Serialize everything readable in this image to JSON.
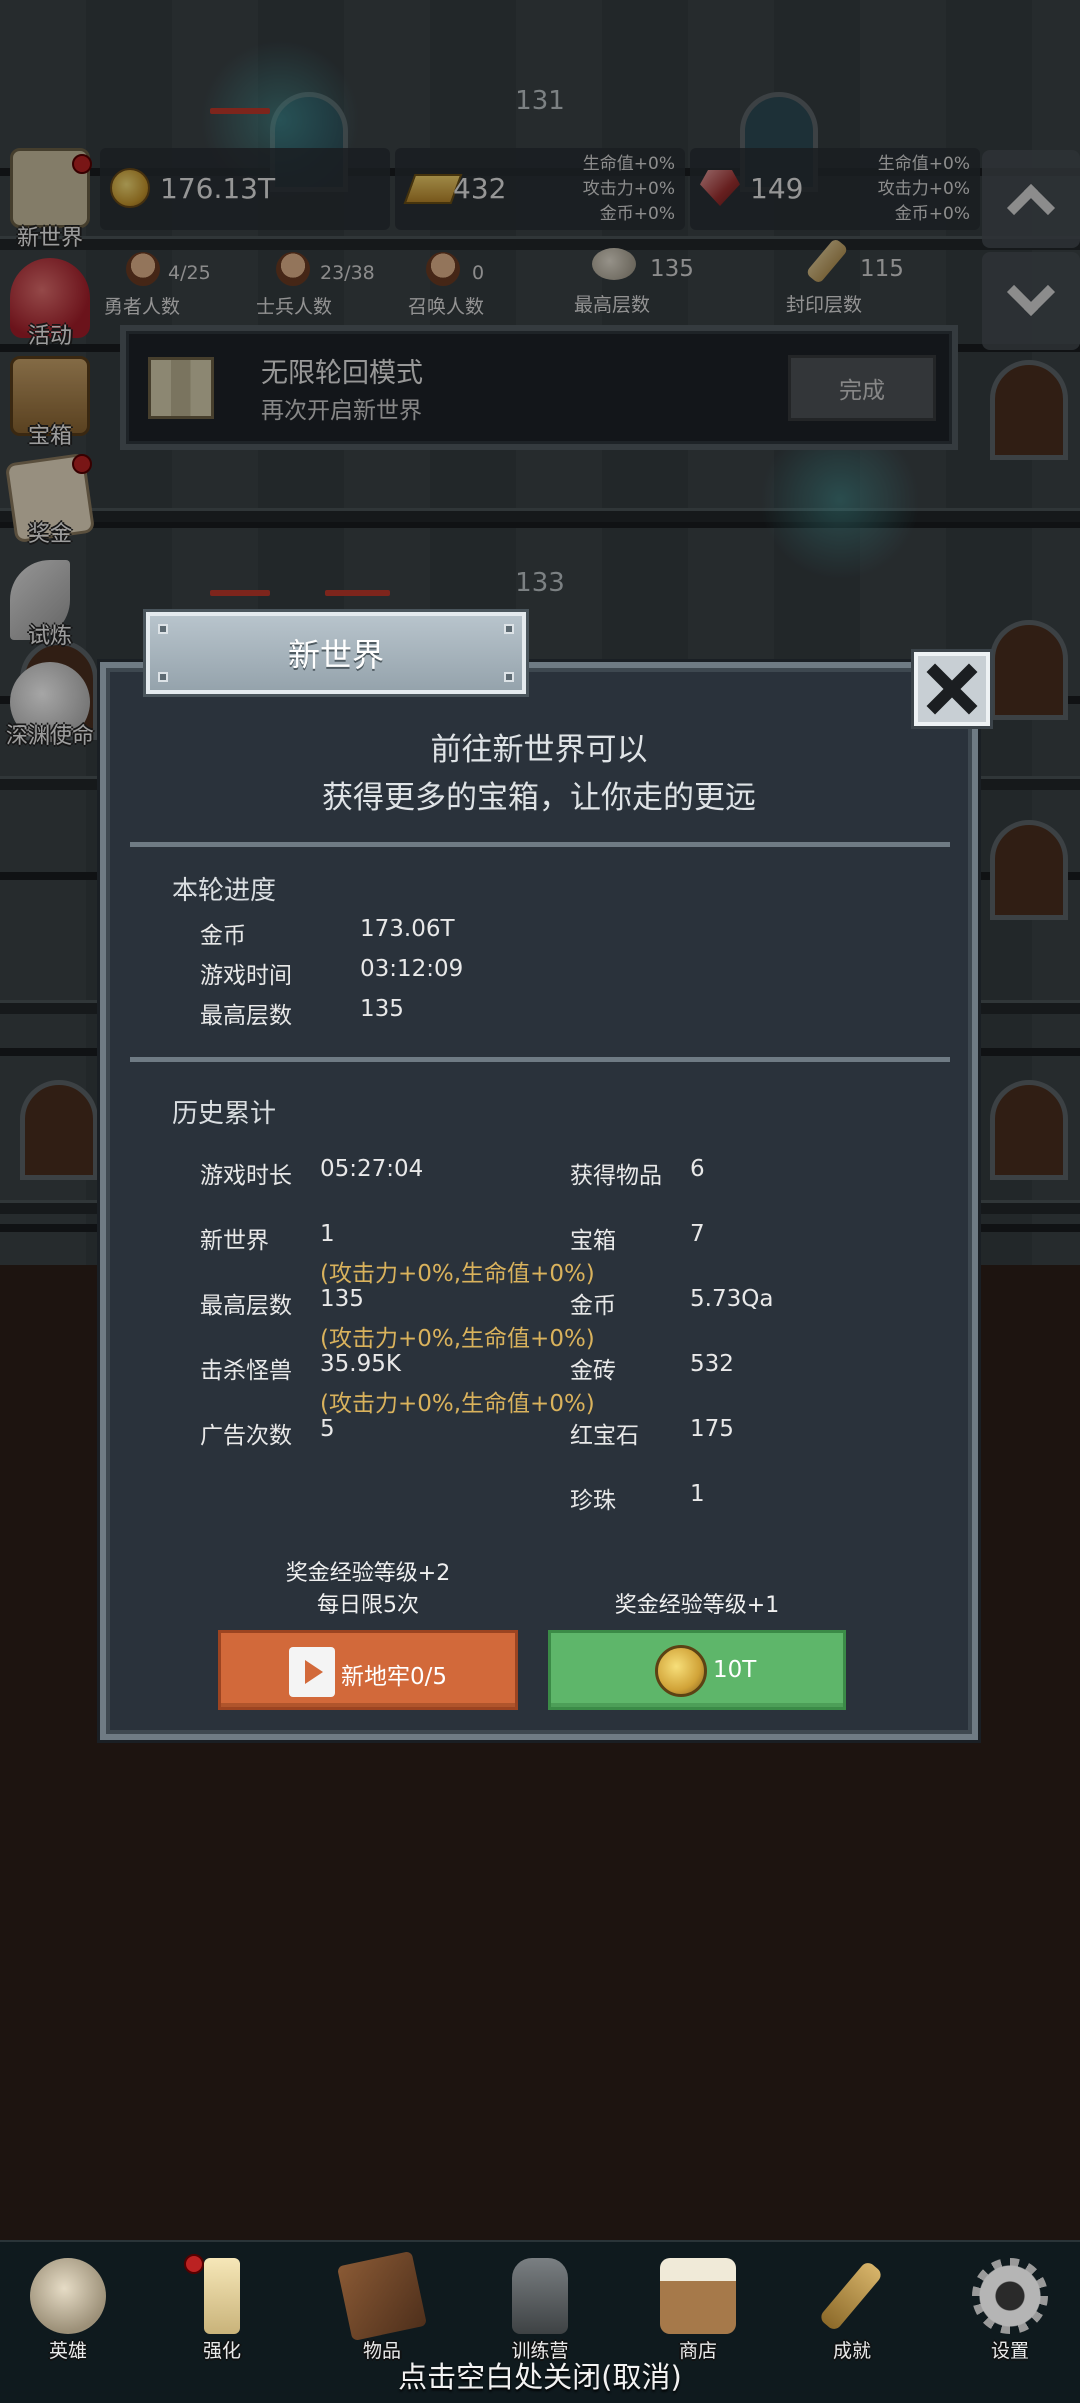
{
  "floors": [
    {
      "number": "131"
    },
    {
      "number": "133"
    }
  ],
  "resources": {
    "coin": {
      "value": "176.13T"
    },
    "gold_bar": {
      "value": "432",
      "bonuses": [
        "生命值+0%",
        "攻击力+0%",
        "金币+0%"
      ]
    },
    "ruby": {
      "value": "149",
      "bonuses": [
        "生命值+0%",
        "攻击力+0%",
        "金币+0%"
      ]
    }
  },
  "stats": [
    {
      "value": "4/25",
      "label": "勇者人数"
    },
    {
      "value": "23/38",
      "label": "士兵人数"
    },
    {
      "value": "0",
      "label": "召唤人数"
    },
    {
      "value": "135",
      "label": "最高层数"
    },
    {
      "value": "115",
      "label": "封印层数"
    }
  ],
  "left_menu": [
    {
      "label": "新世界",
      "badge": true
    },
    {
      "label": "活动",
      "badge": false
    },
    {
      "label": "宝箱",
      "badge": false
    },
    {
      "label": "奖金",
      "badge": true
    },
    {
      "label": "试炼",
      "badge": false
    },
    {
      "label": "深渊使命",
      "badge": false
    }
  ],
  "mode_banner": {
    "title": "无限轮回模式",
    "subtitle": "再次开启新世界",
    "button": "完成"
  },
  "dialog": {
    "title": "新世界",
    "intro_line1": "前往新世界可以",
    "intro_line2": "获得更多的宝箱，让你走的更远",
    "current": {
      "heading": "本轮进度",
      "rows": [
        {
          "label": "金币",
          "value": "173.06T"
        },
        {
          "label": "游戏时间",
          "value": "03:12:09"
        },
        {
          "label": "最高层数",
          "value": "135"
        }
      ]
    },
    "history": {
      "heading": "历史累计",
      "left": [
        {
          "label": "游戏时长",
          "value": "05:27:04",
          "bonus": ""
        },
        {
          "label": "新世界",
          "value": "1",
          "bonus": "(攻击力+0%,生命值+0%)"
        },
        {
          "label": "最高层数",
          "value": "135",
          "bonus": "(攻击力+0%,生命值+0%)"
        },
        {
          "label": "击杀怪兽",
          "value": "35.95K",
          "bonus": "(攻击力+0%,生命值+0%)"
        },
        {
          "label": "广告次数",
          "value": "5",
          "bonus": ""
        }
      ],
      "right": [
        {
          "label": "获得物品",
          "value": "6"
        },
        {
          "label": "宝箱",
          "value": "7"
        },
        {
          "label": "金币",
          "value": "5.73Qa"
        },
        {
          "label": "金砖",
          "value": "532"
        },
        {
          "label": "红宝石",
          "value": "175"
        },
        {
          "label": "珍珠",
          "value": "1"
        }
      ]
    },
    "ad_button": {
      "caption_line1": "奖金经验等级+2",
      "caption_line2": "每日限5次",
      "label": "新地牢0/5"
    },
    "coin_button": {
      "caption": "奖金经验等级+1",
      "label": "10T"
    }
  },
  "bottom_nav": [
    {
      "label": "英雄",
      "badge": false
    },
    {
      "label": "强化",
      "badge": true
    },
    {
      "label": "物品",
      "badge": false
    },
    {
      "label": "训练营",
      "badge": false
    },
    {
      "label": "商店",
      "badge": false
    },
    {
      "label": "成就",
      "badge": false
    },
    {
      "label": "设置",
      "badge": false
    }
  ],
  "close_hint": "点击空白处关闭(取消)",
  "colors": {
    "dialog_bg": "#2a323b",
    "bonus_text": "#d9b25c",
    "ad_button": "#d2693a",
    "coin_button": "#5eb66a"
  }
}
